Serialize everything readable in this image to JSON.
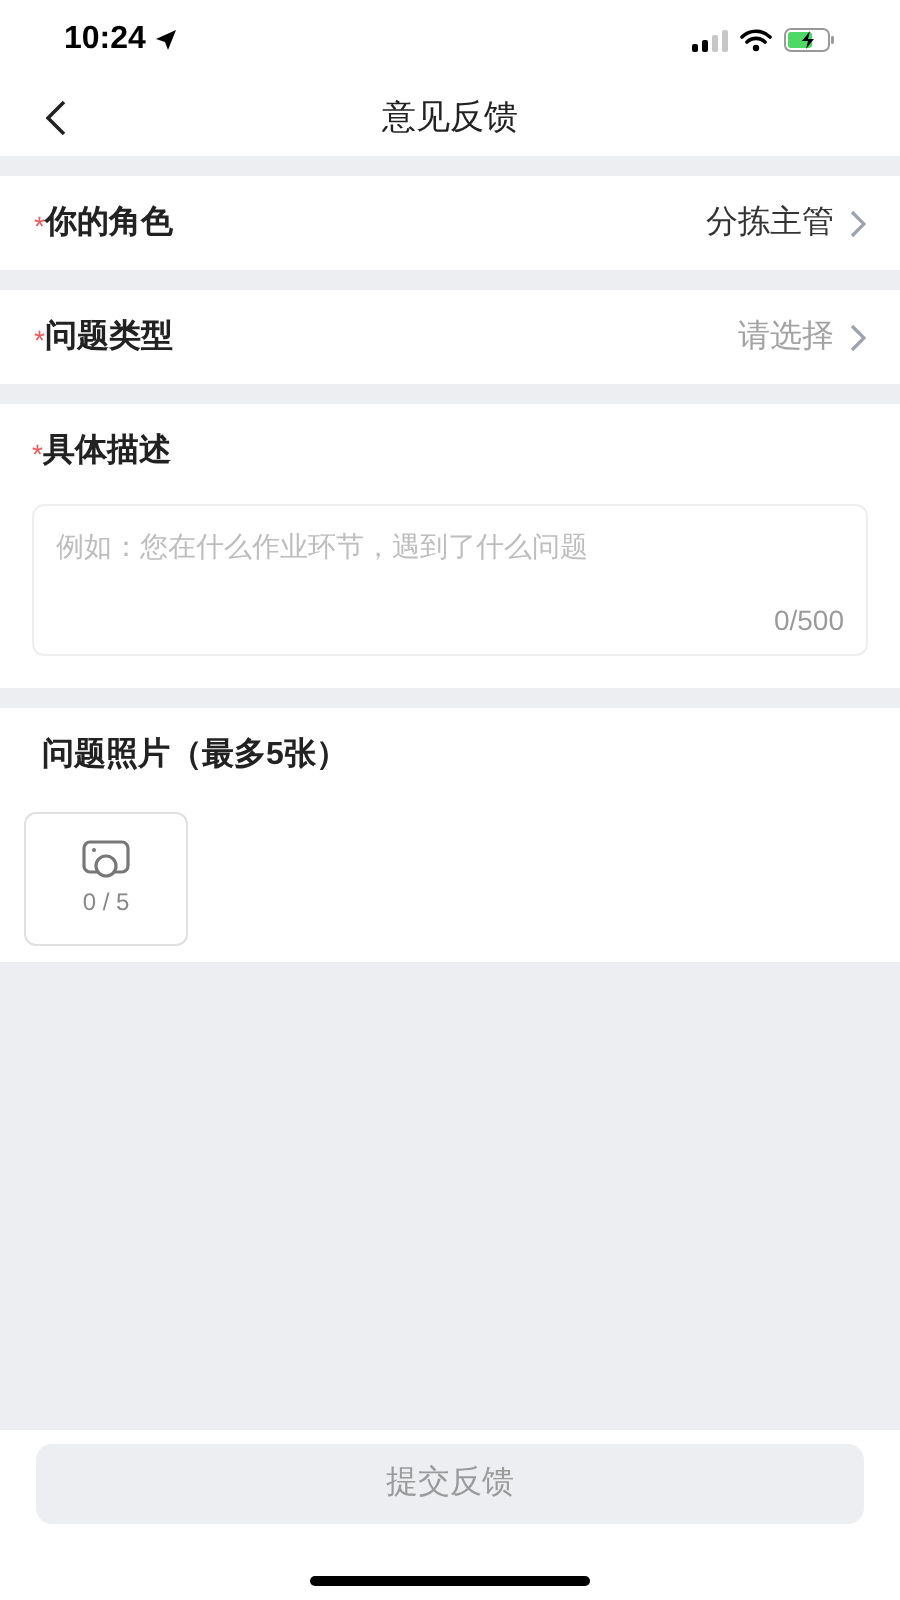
{
  "status_bar": {
    "time": "10:24"
  },
  "nav": {
    "title": "意见反馈"
  },
  "select_rows": [
    {
      "label": "你的角色",
      "required_mark": "*",
      "value": "分拣主管"
    },
    {
      "label": "问题类型",
      "required_mark": "*",
      "placeholder": "请选择"
    }
  ],
  "description": {
    "label": "具体描述",
    "required_mark": "*",
    "placeholder": "例如：您在什么作业环节，遇到了什么问题",
    "counter": "0/500"
  },
  "photos": {
    "label": "问题照片（最多5张）",
    "count": "0 / 5"
  },
  "submit": {
    "label": "提交反馈",
    "disabled": true
  }
}
